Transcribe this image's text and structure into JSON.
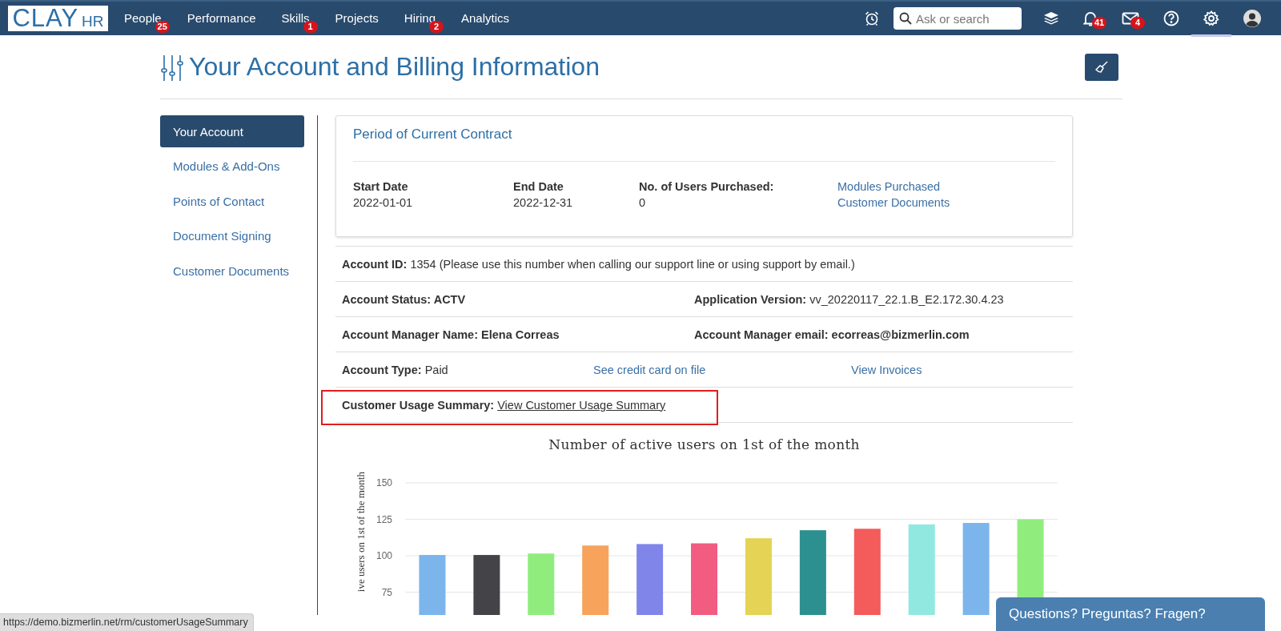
{
  "nav": {
    "logo": {
      "main": "CLAY",
      "sub": "HR"
    },
    "items": [
      {
        "label": "People",
        "badge": "25"
      },
      {
        "label": "Performance"
      },
      {
        "label": "Skills",
        "badge": "1"
      },
      {
        "label": "Projects"
      },
      {
        "label": "Hiring",
        "badge": "2"
      },
      {
        "label": "Analytics"
      }
    ],
    "tools": [
      {
        "kind": "alarm",
        "selected": false
      },
      {
        "kind": "search",
        "placeholder": "Ask or search",
        "selected": false
      },
      {
        "kind": "layers",
        "selected": false
      },
      {
        "kind": "bell",
        "badge": "41",
        "selected": false
      },
      {
        "kind": "mail",
        "badge": "4",
        "selected": false
      },
      {
        "kind": "help",
        "selected": false
      },
      {
        "kind": "gear",
        "selected": true
      },
      {
        "kind": "avatar",
        "selected": false
      }
    ]
  },
  "page": {
    "title": "Your Account and Billing Information"
  },
  "sidebar": {
    "items": [
      {
        "label": "Your Account",
        "selected": true
      },
      {
        "label": "Modules & Add-Ons",
        "selected": false
      },
      {
        "label": "Points of Contact",
        "selected": false
      },
      {
        "label": "Document Signing",
        "selected": false
      },
      {
        "label": "Customer Documents",
        "selected": false
      }
    ]
  },
  "contract": {
    "title": "Period of Current Contract",
    "fields": [
      {
        "label": "Start Date",
        "value": "2022-01-01"
      },
      {
        "label": "End Date",
        "value": "2022-12-31"
      },
      {
        "label": "No. of Users Purchased:",
        "value": "0"
      }
    ],
    "links": [
      "Modules Purchased",
      "Customer Documents"
    ]
  },
  "info_rows": [
    {
      "highlighted": false,
      "cells": [
        {
          "kind": "text",
          "text": "**Account ID:** 1354 (Please use this number when calling our support line or using support by email.)",
          "bold": false
        }
      ]
    },
    {
      "highlighted": false,
      "cells": [
        {
          "kind": "text",
          "text": "Account Status: ACTV",
          "bold": true
        },
        {
          "kind": "text",
          "text": "**Application Version:** vv_20220117_22.1.B_E2.172.30.4.23",
          "bold": false
        }
      ]
    },
    {
      "highlighted": false,
      "cells": [
        {
          "kind": "text",
          "text": "Account Manager Name: Elena Correas",
          "bold": true
        },
        {
          "kind": "text",
          "text": "Account Manager email: ecorreas@bizmerlin.com",
          "bold": true
        }
      ]
    },
    {
      "highlighted": false,
      "cells": [
        {
          "kind": "text",
          "text": "**Account Type:** Paid",
          "bold": false
        },
        {
          "kind": "link",
          "text": "See credit card on file"
        },
        {
          "kind": "link",
          "text": "View Invoices"
        }
      ]
    },
    {
      "highlighted": true,
      "cells": [
        {
          "kind": "label-link",
          "label": "Customer Usage Summary:",
          "text": "View Customer Usage Summary"
        }
      ]
    }
  ],
  "chart": {
    "chart_data": {
      "type": "bar",
      "title": "Number of active users on 1st of the month",
      "ylabel": "ive users on 1st of the month",
      "ylim": [
        50,
        150
      ],
      "yticks": [
        75,
        100,
        125,
        150
      ],
      "grid": true,
      "values": [
        100.5,
        100.5,
        101.5,
        107,
        108,
        108.5,
        112,
        117.5,
        118.5,
        121.5,
        122.5,
        125
      ],
      "colors": [
        "#7cb5ec",
        "#434348",
        "#90ed7d",
        "#f7a35c",
        "#8085e9",
        "#f15c80",
        "#e4d354",
        "#2b908f",
        "#f45b5b",
        "#91e8e1",
        "#7cb5ec",
        "#90ed7d"
      ]
    }
  },
  "status_url": "https://demo.bizmerlin.net/rm/customerUsageSummary",
  "chat_button": "Questions? Preguntas? Fragen?"
}
